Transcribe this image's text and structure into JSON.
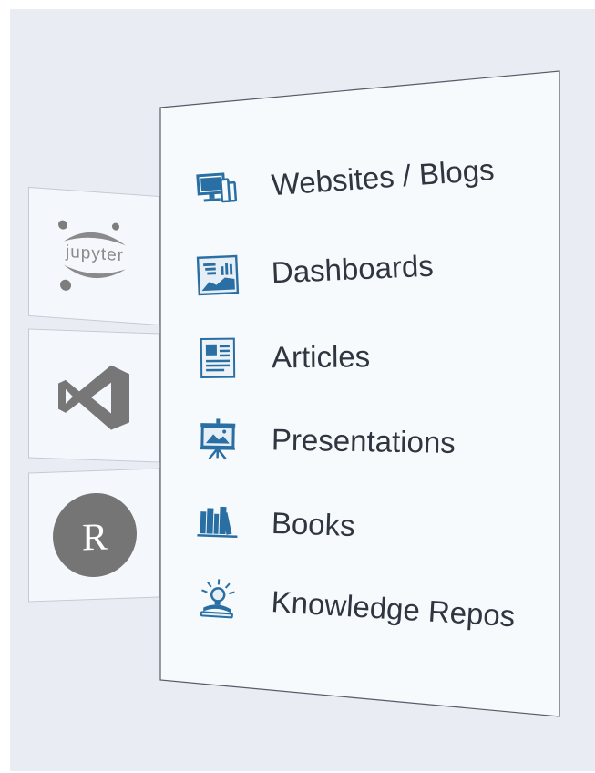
{
  "left_tiles": [
    {
      "name": "jupyter",
      "label": "jupyter"
    },
    {
      "name": "vscode",
      "label": ""
    },
    {
      "name": "r",
      "label": "R"
    }
  ],
  "output_formats": [
    {
      "label": "Websites / Blogs",
      "icon": "devices-icon"
    },
    {
      "label": "Dashboards",
      "icon": "dashboard-icon"
    },
    {
      "label": "Articles",
      "icon": "article-icon"
    },
    {
      "label": "Presentations",
      "icon": "presentation-icon"
    },
    {
      "label": "Books",
      "icon": "books-icon"
    },
    {
      "label": "Knowledge Repos",
      "icon": "knowledge-icon"
    }
  ],
  "colors": {
    "accent": "#2a6fa3",
    "background": "#e9edf3",
    "panel": "#f7fafd",
    "text": "#2f3640",
    "tile_icon": "#767676"
  }
}
